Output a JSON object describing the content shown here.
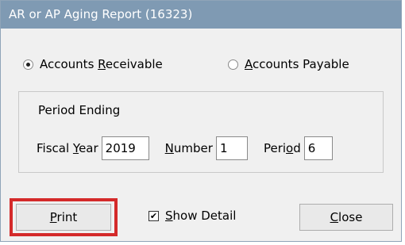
{
  "window": {
    "title": "AR or AP Aging Report (16323)"
  },
  "report_type": {
    "options": [
      {
        "label_pre": "Accounts ",
        "label_u": "R",
        "label_post": "eceivable",
        "checked": true
      },
      {
        "label_pre": "",
        "label_u": "A",
        "label_post": "ccounts Payable",
        "checked": false
      }
    ]
  },
  "period": {
    "group_title": "Period Ending",
    "fiscal_year": {
      "label_pre": "Fiscal ",
      "label_u": "Y",
      "label_post": "ear",
      "value": "2019"
    },
    "number": {
      "label_pre": "",
      "label_u": "N",
      "label_post": "umber",
      "value": "1"
    },
    "period": {
      "label_pre": "Peri",
      "label_u": "o",
      "label_post": "d",
      "value": "6"
    }
  },
  "footer": {
    "print": {
      "label_pre": "",
      "label_u": "P",
      "label_post": "rint"
    },
    "show_detail": {
      "label_pre": "",
      "label_u": "S",
      "label_post": "how Detail",
      "checked": true,
      "check_mark": "✔"
    },
    "close": {
      "label_pre": "",
      "label_u": "C",
      "label_post": "lose"
    }
  },
  "colors": {
    "titlebar": "#7f9ab3",
    "highlight": "#d42a2a"
  }
}
